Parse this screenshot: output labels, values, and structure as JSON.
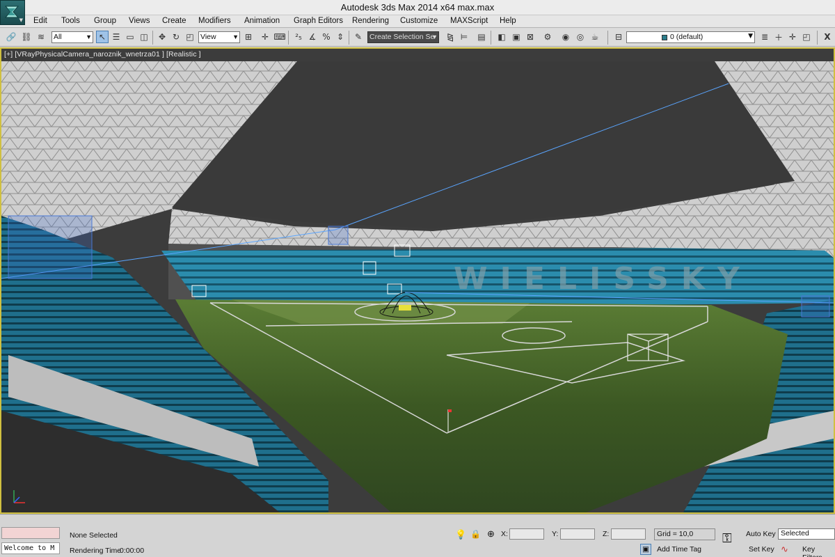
{
  "titlebar": {
    "title": "Autodesk 3ds Max  2014 x64       max.max"
  },
  "menu": {
    "items": [
      "Edit",
      "Tools",
      "Group",
      "Views",
      "Create",
      "Modifiers",
      "Animation",
      "Graph Editors",
      "Rendering",
      "Customize",
      "MAXScript",
      "Help"
    ]
  },
  "toolbar": {
    "selection_filter": "All",
    "reference_coord": "View",
    "selection_set_placeholder": "Create Selection Se",
    "layer_name": "0 (default)",
    "close_label": "X"
  },
  "viewport": {
    "label": "[+] [VRayPhysicalCamera_naroznik_wnetrza01 ] [Realistic ]",
    "stadium_lettering": "WIELISSKY"
  },
  "status": {
    "selection": "None Selected",
    "rendering_time_label": "Rendering Time",
    "rendering_time_value": "0:00:00",
    "welcome_text": "Welcome to M",
    "x_label": "X:",
    "y_label": "Y:",
    "z_label": "Z:",
    "grid_label": "Grid = 10,0",
    "add_time_tag": "Add Time Tag",
    "auto_key": "Auto Key",
    "set_key": "Set Key",
    "selected": "Selected",
    "key_filters": "Key Filters..."
  },
  "colors": {
    "viewport_border": "#d0c040",
    "seat_blue": "#2a8fb0",
    "pitch_green": "#3f5a1f",
    "roof_grey": "#c8c8c8",
    "sky": "#3a3a3a",
    "app_icon": "#2d6f73"
  }
}
